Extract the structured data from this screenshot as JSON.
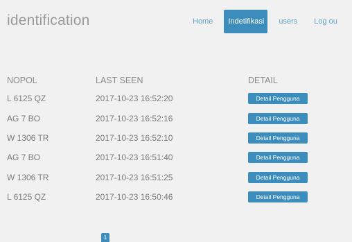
{
  "app": {
    "title": "identification"
  },
  "nav": {
    "home": "Home",
    "identifikasi": "Indetifikasi",
    "users": "users",
    "logout": "Log ou"
  },
  "table": {
    "headers": [
      "NOPOL",
      "LAST SEEN",
      "DETAIL"
    ],
    "rows": [
      {
        "nopol": "L 6125 QZ",
        "last_seen": "2017-10-23 16:52:20",
        "detail": "Detail Pengguna"
      },
      {
        "nopol": "AG 7 BO",
        "last_seen": "2017-10-23 16:52:16",
        "detail": "Detail Pengguna"
      },
      {
        "nopol": "W 1306 TR",
        "last_seen": "2017-10-23 16:52:10",
        "detail": "Detail Pengguna"
      },
      {
        "nopol": "AG 7 BO",
        "last_seen": "2017-10-23 16:51:40",
        "detail": "Detail Pengguna"
      },
      {
        "nopol": "W 1306 TR",
        "last_seen": "2017-10-23 16:51:25",
        "detail": "Detail Pengguna"
      },
      {
        "nopol": "L 6125 QZ",
        "last_seen": "2017-10-23 16:50:46",
        "detail": "Detail Pengguna"
      }
    ]
  },
  "pagination": {
    "current": "1"
  },
  "colors": {
    "accent": "#3c8dbc",
    "background": "#f1f1f1",
    "text": "#7a7a7a"
  }
}
